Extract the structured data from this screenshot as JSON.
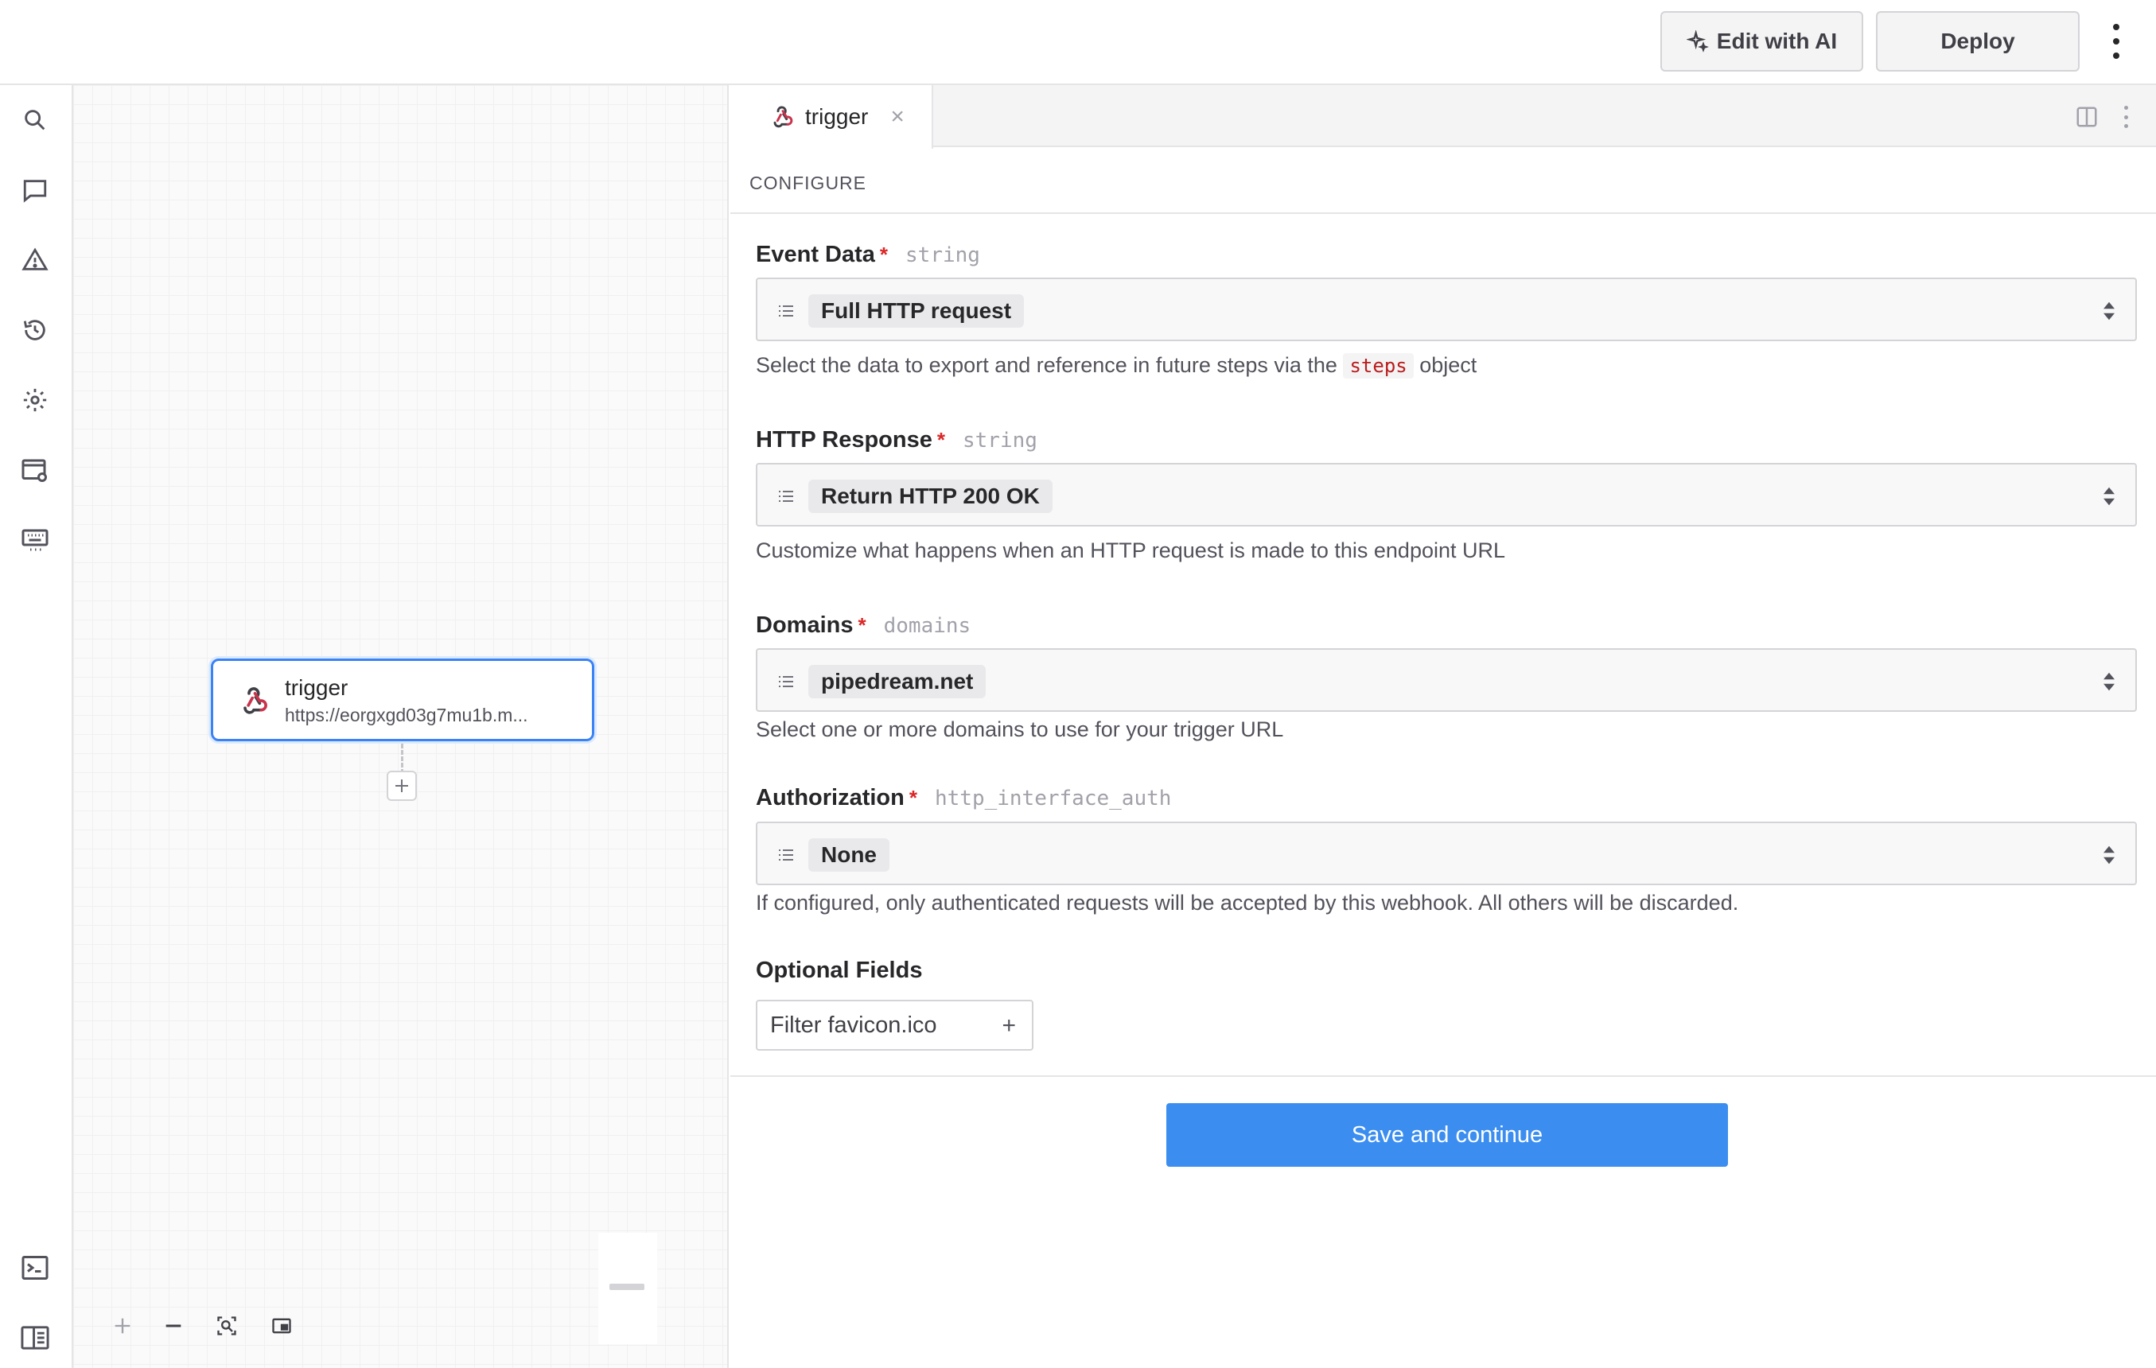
{
  "header": {
    "edit_ai_label": "Edit with AI",
    "deploy_label": "Deploy"
  },
  "rail": {
    "icons": [
      "search-icon",
      "comment-icon",
      "warning-icon",
      "history-icon",
      "settings-icon",
      "window-settings-icon",
      "keyboard-icon",
      "terminal-icon",
      "panel-toggle-icon"
    ]
  },
  "canvas": {
    "node": {
      "title": "trigger",
      "url": "https://eorgxgd03g7mu1b.m..."
    }
  },
  "panel": {
    "tab": {
      "label": "trigger",
      "close": "×"
    },
    "section": "CONFIGURE",
    "fields": [
      {
        "label": "Event Data",
        "required": "*",
        "type": "string",
        "value": "Full HTTP request",
        "help_before": "Select the data to export and reference in future steps via the",
        "help_code": "steps",
        "help_after": "object"
      },
      {
        "label": "HTTP Response",
        "required": "*",
        "type": "string",
        "value": "Return HTTP 200 OK",
        "help": "Customize what happens when an HTTP request is made to this endpoint URL"
      },
      {
        "label": "Domains",
        "required": "*",
        "type": "domains",
        "value": "pipedream.net",
        "help": "Select one or more domains to use for your trigger URL"
      },
      {
        "label": "Authorization",
        "required": "*",
        "type": "http_interface_auth",
        "value": "None",
        "help": "If configured, only authenticated requests will be accepted by this webhook. All others will be discarded."
      }
    ],
    "optional": {
      "title": "Optional Fields",
      "button": "Filter favicon.ico",
      "plus": "+"
    },
    "save_label": "Save and continue"
  },
  "colors": {
    "accent": "#3b8ef0",
    "required": "#dc2626",
    "node_border": "#3b82f6"
  }
}
